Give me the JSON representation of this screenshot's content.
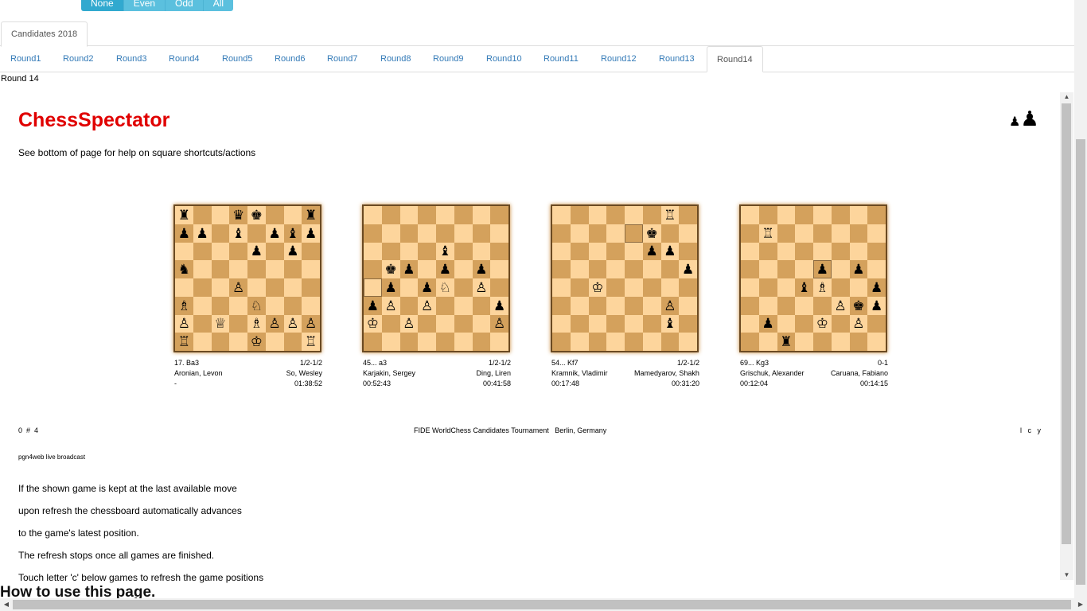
{
  "filter_buttons": [
    "None",
    "Even",
    "Odd",
    "All"
  ],
  "event_tab": "Candidates 2018",
  "round_tabs": [
    "Round1",
    "Round2",
    "Round3",
    "Round4",
    "Round5",
    "Round6",
    "Round7",
    "Round8",
    "Round9",
    "Round10",
    "Round11",
    "Round12",
    "Round13",
    "Round14"
  ],
  "active_round_tab": "Round14",
  "round_label": "Round 14",
  "site_title": "ChessSpectator",
  "subtitle": "See bottom of page for help on square shortcuts/actions",
  "logo_icon": "pawns-logo-icon",
  "games": [
    {
      "last_move": "17. Ba3",
      "result": "1/2-1/2",
      "white": "Aronian, Levon",
      "black": "So, Wesley",
      "white_clock": "-",
      "black_clock": "01:38:52",
      "position": [
        "r..qk..r",
        "p.p.b.pbp",
        "",
        "",
        "",
        "",
        "",
        ""
      ],
      "fen": "r2qk2r/pp1b1pbp/4p1p1/n7/3P4/B3N3/P1Q1BPPP/R3K2R",
      "highlight": []
    },
    {
      "last_move": "45... a3",
      "result": "1/2-1/2",
      "white": "Karjakin, Sergey",
      "black": "Ding, Liren",
      "white_clock": "00:52:43",
      "black_clock": "00:41:58",
      "fen": "8/8/4b3/1kp1p1p1/1p1pN1P1/pP1P3p/K1P4P/8",
      "highlight": [
        "a4"
      ]
    },
    {
      "last_move": "54... Kf7",
      "result": "1/2-1/2",
      "white": "Kramnik, Vladimir",
      "black": "Mamedyarov, Shakhriyar",
      "white_clock": "00:17:48",
      "black_clock": "00:31:20",
      "fen": "6R1/5k2/5pp1/7p/2K5/6P1/6b1/8",
      "highlight": [
        "e7"
      ]
    },
    {
      "last_move": "69... Kg3",
      "result": "0-1",
      "white": "Grischuk, Alexander",
      "black": "Caruana, Fabiano",
      "white_clock": "00:12:04",
      "black_clock": "00:14:15",
      "fen": "8/1R6/8/4p1p1/3bB2p/5Pkp/1p2K1P1/2r5",
      "highlight": [
        "e5"
      ]
    }
  ],
  "footer": {
    "counter": "0  #  4",
    "event": "FIDE WorldChess Candidates Tournament   Berlin, Germany",
    "controls": "l   c   y"
  },
  "pgn_label": "pgn4web live broadcast",
  "help_lines": [
    "If the shown game is kept at the last available move",
    "upon refresh the chessboard automatically advances",
    "to the game's latest position.",
    "The refresh stops once all games are finished.",
    "Touch letter 'c' below games to refresh the game positions"
  ],
  "how_to": "How to use this page."
}
